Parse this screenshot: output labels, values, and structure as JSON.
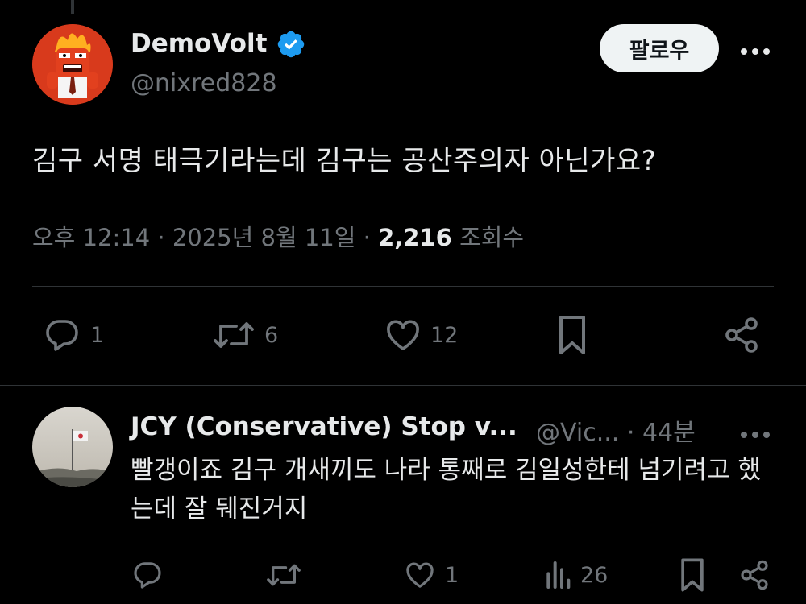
{
  "tweet": {
    "display_name": "DemoVolt",
    "handle": "@nixred828",
    "follow_label": "팔로우",
    "text": "김구 서명 태극기라는데 김구는 공산주의자 아닌가요?",
    "time": "오후 12:14",
    "separator": "·",
    "date": "2025년 8월 11일",
    "views_count": "2,216",
    "views_label": "조회수",
    "actions": {
      "replies": "1",
      "retweets": "6",
      "likes": "12"
    }
  },
  "reply": {
    "display_name": "JCY (Conservative) Stop v...",
    "handle": "@Vic...",
    "separator": "·",
    "time": "44분",
    "text": "빨갱이죠 김구 개새끼도 나라 통째로 김일성한테 넘기려고 했는데 잘 뒈진거지",
    "actions": {
      "replies": "",
      "retweets": "",
      "likes": "1",
      "views": "26"
    }
  },
  "colors": {
    "background": "#000000",
    "text_primary": "#e7e9ea",
    "text_secondary": "#71767b",
    "verified_badge": "#1d9bf0",
    "divider": "#2f3336"
  },
  "icons": [
    "verified-badge-icon",
    "more-icon",
    "reply-icon",
    "retweet-icon",
    "like-icon",
    "bookmark-icon",
    "share-icon",
    "views-icon"
  ]
}
